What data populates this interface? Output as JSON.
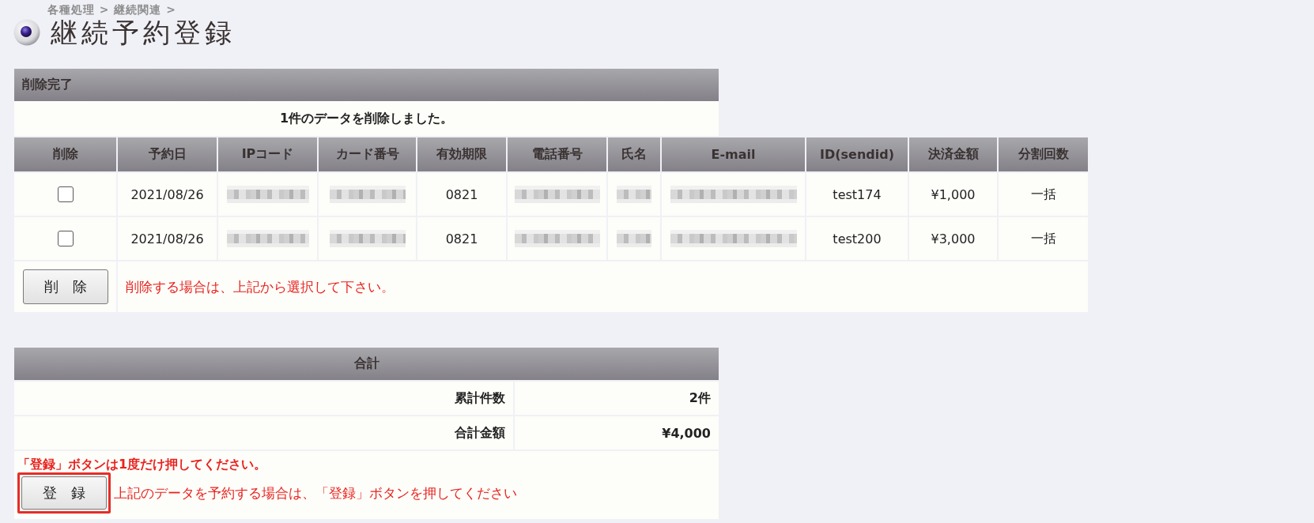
{
  "breadcrumb": "各種処理 > 継続関連 >",
  "page_title": "継続予約登録",
  "deletion_panel": {
    "title": "削除完了",
    "message": "1件のデータを削除しました。"
  },
  "reservations_table": {
    "columns": [
      "削除",
      "予約日",
      "IPコード",
      "カード番号",
      "有効期限",
      "電話番号",
      "氏名",
      "E-mail",
      "ID(sendid)",
      "決済金額",
      "分割回数"
    ],
    "rows": [
      {
        "cells": [
          {
            "kind": "checkbox",
            "checked": false
          },
          {
            "kind": "text",
            "text": "2021/08/26"
          },
          {
            "kind": "redacted"
          },
          {
            "kind": "redacted"
          },
          {
            "kind": "text",
            "text": "0821"
          },
          {
            "kind": "redacted"
          },
          {
            "kind": "redacted"
          },
          {
            "kind": "redacted"
          },
          {
            "kind": "text",
            "text": "test174"
          },
          {
            "kind": "text",
            "text": "¥1,000"
          },
          {
            "kind": "text",
            "text": "一括"
          }
        ]
      },
      {
        "cells": [
          {
            "kind": "checkbox",
            "checked": false
          },
          {
            "kind": "text",
            "text": "2021/08/26"
          },
          {
            "kind": "redacted"
          },
          {
            "kind": "redacted"
          },
          {
            "kind": "text",
            "text": "0821"
          },
          {
            "kind": "redacted"
          },
          {
            "kind": "redacted"
          },
          {
            "kind": "redacted"
          },
          {
            "kind": "text",
            "text": "test200"
          },
          {
            "kind": "text",
            "text": "¥3,000"
          },
          {
            "kind": "text",
            "text": "一括"
          }
        ]
      }
    ],
    "delete_button": "削　除",
    "delete_hint": "削除する場合は、上記から選択して下さい。"
  },
  "total_panel": {
    "title": "合計",
    "rows": [
      {
        "label": "累計件数",
        "value": "2件"
      },
      {
        "label": "合計金額",
        "value": "¥4,000"
      }
    ],
    "warning": "「登録」ボタンは1度だけ押してください。",
    "register_button": {
      "label": "登　録",
      "highlighted": true
    },
    "register_hint": "上記のデータを予約する場合は、「登録」ボタンを押してください"
  }
}
